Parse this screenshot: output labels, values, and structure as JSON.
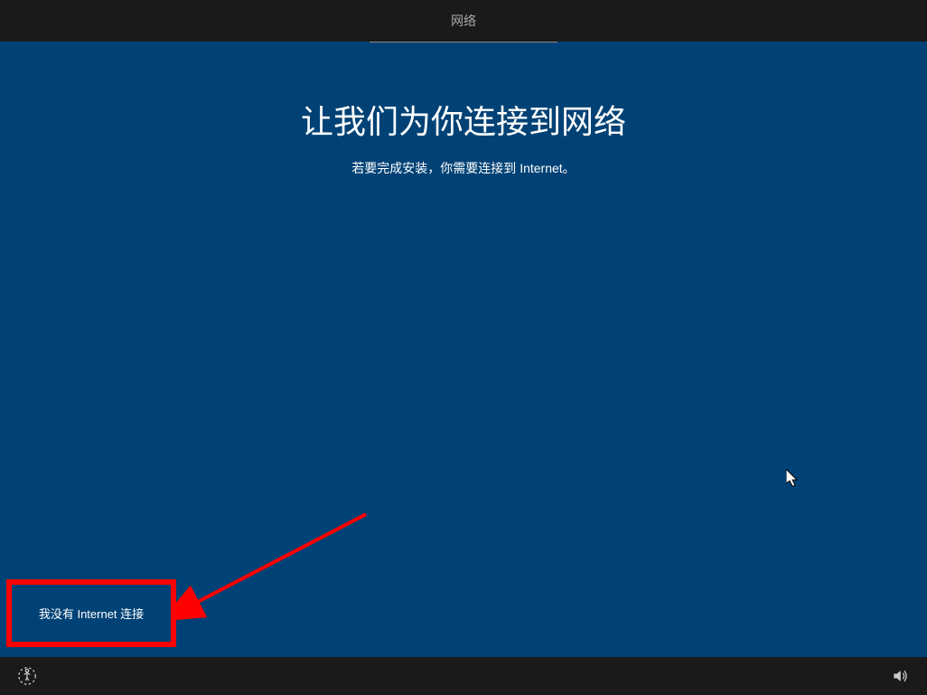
{
  "tab": {
    "label": "网络"
  },
  "main": {
    "title": "让我们为你连接到网络",
    "subtitle": "若要完成安装，你需要连接到 Internet。"
  },
  "buttons": {
    "no_internet_label": "我没有 Internet 连接"
  },
  "icons": {
    "accessibility": "accessibility-icon",
    "volume": "volume-icon"
  }
}
